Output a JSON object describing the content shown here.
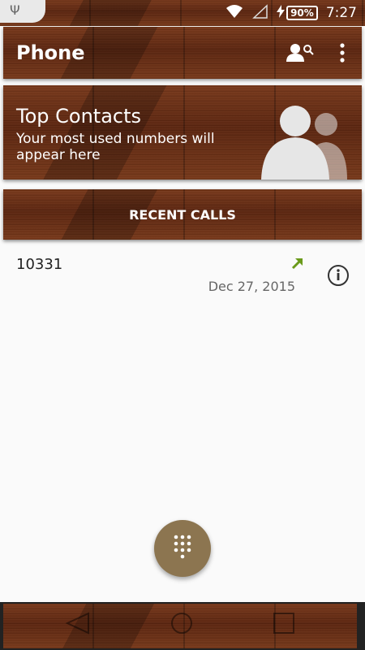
{
  "status_bar": {
    "time": "7:27",
    "battery_percent": "90%",
    "usb_icon": "usb-icon",
    "wifi_icon": "wifi-icon",
    "signal_icon": "signal-icon",
    "charging_icon": "charging-bolt-icon"
  },
  "header": {
    "title": "Phone",
    "search_icon": "contact-search-icon",
    "menu_icon": "overflow-menu-icon"
  },
  "top_contacts": {
    "title": "Top Contacts",
    "subtitle": "Your most used numbers will appear here"
  },
  "tabs": {
    "recent_calls": "RECENT CALLS"
  },
  "calls": [
    {
      "number": "10331",
      "date": "Dec 27, 2015",
      "type": "outgoing",
      "type_color": "#6a9a1a"
    }
  ],
  "fab": {
    "icon": "dialpad-icon",
    "color": "#8c7550"
  },
  "nav": {
    "back": "back-icon",
    "home": "home-icon",
    "recents": "recents-icon"
  }
}
